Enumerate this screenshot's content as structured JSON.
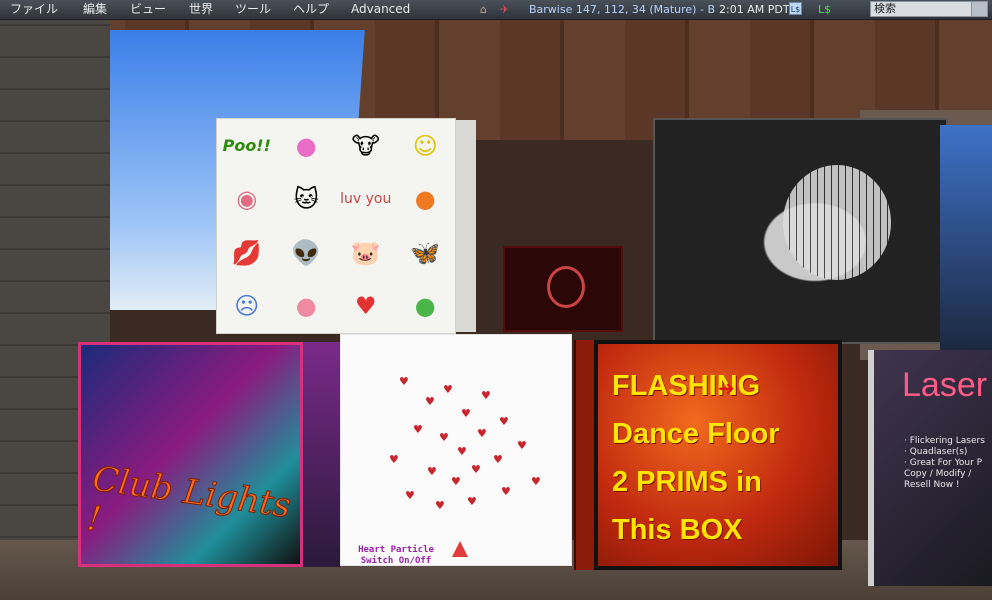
{
  "menu": {
    "items": [
      "ファイル",
      "編集",
      "ビュー",
      "世界",
      "ツール",
      "ヘルプ",
      "Advanced"
    ]
  },
  "status": {
    "location": "Barwise 147, 112, 34 (Mature) - B",
    "time": "2:01 AM PDT",
    "currency_button": "L$",
    "balance": "L$",
    "search_placeholder": "検索"
  },
  "scene": {
    "heart_label_line1": "Heart Particle",
    "heart_label_line2": "Switch On/Off",
    "club_text": "Club Lights !",
    "flash_lines": [
      "FLASHING",
      "Dance Floor",
      "2 PRIMS in",
      "This BOX"
    ],
    "laser_title": "Laser",
    "laser_lines": [
      "· Flickering Lasers",
      "· Quadlaser(s)",
      "· Great For Your P",
      "  Copy / Modify /",
      "  Resell Now !"
    ],
    "emoji_labels": [
      "Poo!!",
      "",
      "",
      "☺",
      "",
      "",
      "luv you",
      "",
      "",
      "",
      "",
      "",
      "☹",
      "",
      "♥",
      ""
    ]
  },
  "colors": {
    "accent_magenta": "#d7317d",
    "flash_yellow": "#ffe400",
    "laser_pink": "#ff5b86"
  }
}
